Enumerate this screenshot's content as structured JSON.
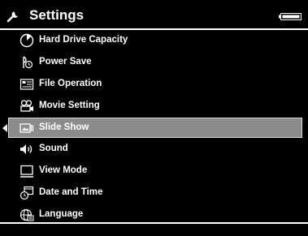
{
  "header": {
    "title": "Settings",
    "icon": "wrench-icon",
    "battery_icon": "battery-icon"
  },
  "menu": {
    "selected_index": 5,
    "items": [
      {
        "label": "Hard Drive Capacity",
        "icon": "pie-chart-icon"
      },
      {
        "label": "Power Save",
        "icon": "power-save-icon"
      },
      {
        "label": "File Operation",
        "icon": "file-operation-icon"
      },
      {
        "label": "Movie Setting",
        "icon": "movie-camera-icon"
      },
      {
        "label": "Slide Show",
        "icon": "slide-show-icon"
      },
      {
        "label": "Sound",
        "icon": "speaker-icon"
      },
      {
        "label": "View Mode",
        "icon": "monitor-icon"
      },
      {
        "label": "Date and Time",
        "icon": "clock-icon"
      },
      {
        "label": "Language",
        "icon": "globe-icon"
      }
    ]
  },
  "colors": {
    "background": "#000000",
    "text": "#ffffff",
    "selection": "#8c8c8c"
  }
}
